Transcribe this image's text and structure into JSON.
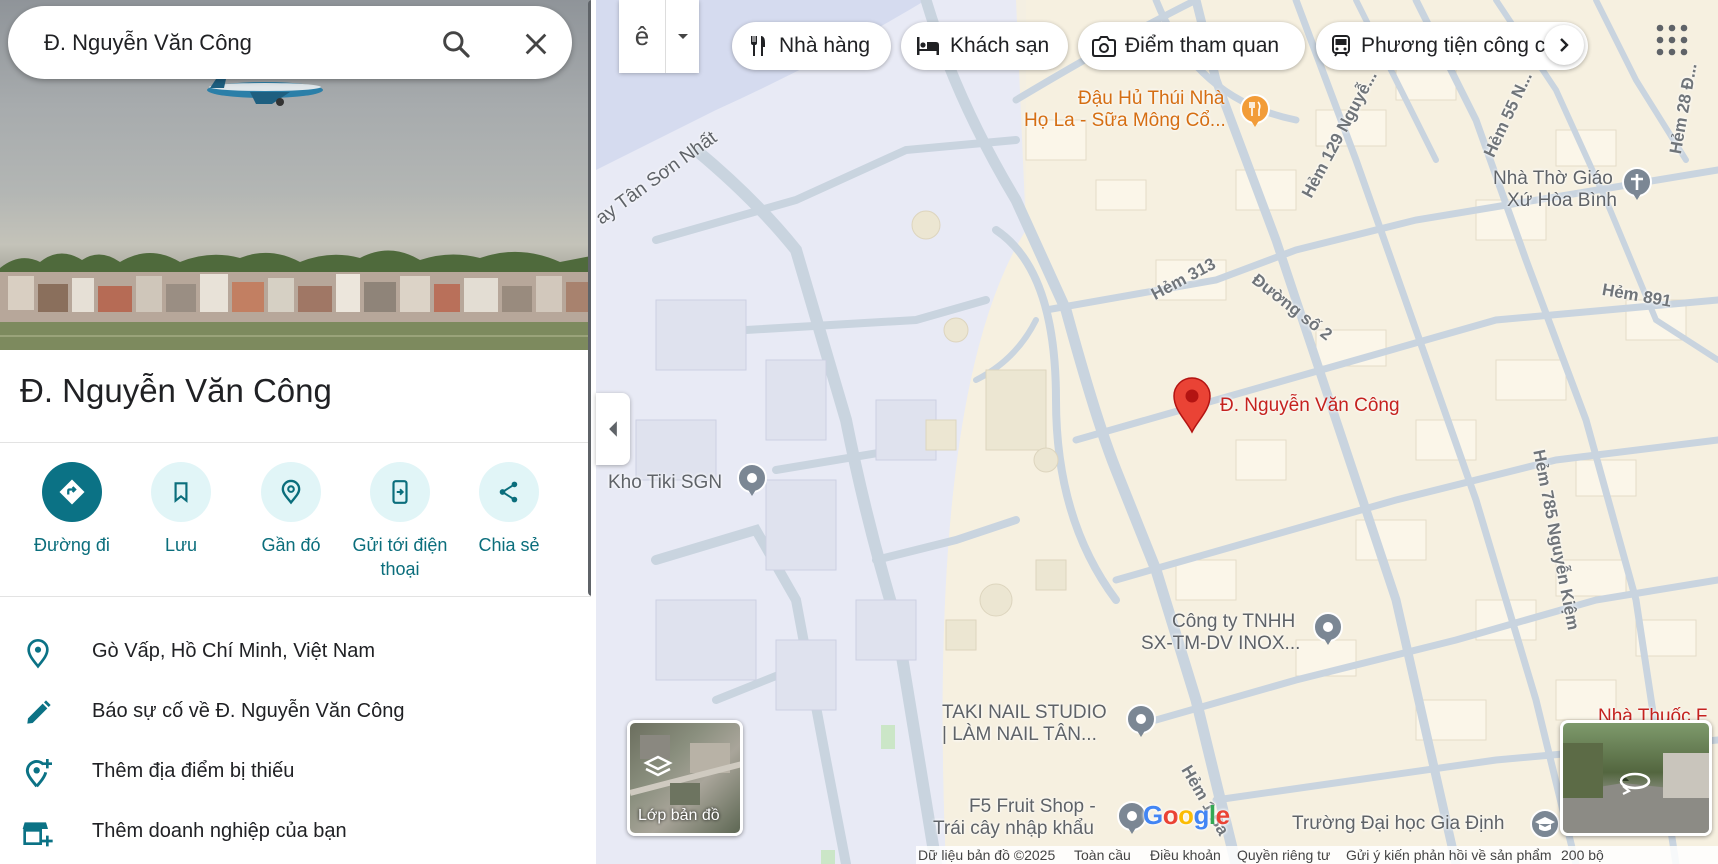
{
  "search": {
    "query": "Đ. Nguyễn Văn Công"
  },
  "place": {
    "title": "Đ. Nguyễn Văn Công"
  },
  "actions": [
    {
      "label": "Đường đi",
      "icon": "directions-icon"
    },
    {
      "label": "Lưu",
      "icon": "bookmark-icon"
    },
    {
      "label": "Gần đó",
      "icon": "nearby-icon"
    },
    {
      "label": "Gửi tới điện thoại",
      "icon": "send-to-phone-icon"
    },
    {
      "label": "Chia sẻ",
      "icon": "share-icon"
    }
  ],
  "info_rows": [
    {
      "text": "Gò Vấp, Hồ Chí Minh, Việt Nam",
      "icon": "location-pin-icon"
    },
    {
      "text": "Báo sự cố về Đ. Nguyễn Văn Công",
      "icon": "pencil-icon"
    },
    {
      "text": "Thêm địa điểm bị thiếu",
      "icon": "add-location-icon"
    },
    {
      "text": "Thêm doanh nghiệp của bạn",
      "icon": "add-business-icon"
    }
  ],
  "map": {
    "transit_toggle_glyph": "ê",
    "chips": [
      {
        "label": "Nhà hàng",
        "icon": "restaurant-icon"
      },
      {
        "label": "Khách sạn",
        "icon": "hotel-icon"
      },
      {
        "label": "Điểm tham quan",
        "icon": "camera-icon"
      },
      {
        "label": "Phương tiện công cộng",
        "icon": "transit-icon"
      }
    ],
    "labels": {
      "tan_son_nhat": "ay Tân Sơn Nhất",
      "dau_hu_1": "Đậu Hủ Thúi Nhà",
      "dau_hu_2": "Họ La - Sữa Mông Cổ...",
      "church_1": "Nhà Thờ Giáo",
      "church_2": "Xứ Hòa Bình",
      "hem_129": "Hẻm 129 Nguyễ...",
      "hem_55": "Hẻm 55 N...",
      "hem_28": "Hẻm 28 Đ...",
      "hem_313": "Hẻm 313",
      "duong_so_2": "Đường số 2",
      "hem_891": "Hẻm 891",
      "hem_785": "Hẻm 785 Nguyễn Kiệm",
      "pin_label": "Đ. Nguyễn Văn Công",
      "kho_tiki": "Kho Tiki SGN",
      "inox_1": "Công ty TNHH",
      "inox_2": "SX-TM-DV INOX...",
      "taki_1": "TAKI NAIL STUDIO",
      "taki_2": "| LÀM NAIL TÂN...",
      "f5_1": "F5 Fruit Shop -",
      "f5_2": "Trái cây nhập khẩu",
      "hem_1": "Hẻm 1 Ba",
      "truong": "Trường Đại học Gia Định",
      "nha_thuoc": "Nhà Thuốc F"
    },
    "layers_label": "Lớp bản đồ",
    "google_logo": "Google",
    "footer": {
      "data": "Dữ liệu bản đồ ©2025",
      "global": "Toàn cầu",
      "terms": "Điều khoản",
      "privacy": "Quyền riêng tư",
      "feedback": "Gửi ý kiến phản hồi về sản phẩm",
      "scale": "200 bộ"
    }
  },
  "colors": {
    "accent": "#0b7285",
    "action_bg": "#e1f5f7",
    "pin_red": "#ea4335",
    "food_orange": "#f29c38",
    "poi_gray": "#7b8794",
    "map_land": "#f4efe2",
    "map_road": "#c9d4df"
  }
}
